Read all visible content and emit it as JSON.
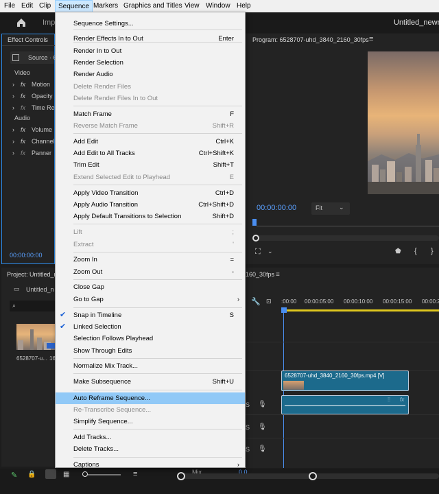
{
  "menubar": [
    "File",
    "Edit",
    "Clip",
    "Sequence",
    "Markers",
    "Graphics and Titles",
    "View",
    "Window",
    "Help"
  ],
  "header": {
    "import_label": "Imp",
    "project_title": "Untitled_newn"
  },
  "effect_controls": {
    "title": "Effect Controls",
    "source_label": "Source · 6",
    "video_label": "Video",
    "audio_label": "Audio",
    "video_effects": [
      "Motion",
      "Opacity",
      "Time Re"
    ],
    "audio_effects": [
      "Volume",
      "Channel",
      "Panner"
    ],
    "timecode": "00:00:00:00"
  },
  "program": {
    "title": "Program: 6528707-uhd_3840_2160_30fps",
    "timecode": "00:00:00:00",
    "fit_label": "Fit"
  },
  "project": {
    "title": "Project: Untitled_n",
    "bin_label": "Untitled_n",
    "clip_name": "6528707-u...",
    "clip_extra": "16"
  },
  "timeline": {
    "seq_tab": "160_30fps",
    "ruler": [
      ":00:00",
      "00:00:05:00",
      "00:00:10:00",
      "00:00:15:00",
      "00:00:2"
    ],
    "video_clip": "6528707-uhd_3840_2160_30fps.mp4 [V]",
    "track_s": "S",
    "mix_label": "Mix",
    "mix_value": "0.0"
  },
  "menu": {
    "items": [
      {
        "label": "Sequence Settings...",
        "shortcut": "",
        "disabled": false,
        "checked": false,
        "submenu": false,
        "highlight": false
      },
      {
        "label": "Render Effects In to Out",
        "shortcut": "Enter",
        "disabled": false,
        "checked": false,
        "submenu": false,
        "highlight": false
      },
      {
        "label": "Render In to Out",
        "shortcut": "",
        "disabled": false,
        "checked": false,
        "submenu": false,
        "highlight": false
      },
      {
        "label": "Render Selection",
        "shortcut": "",
        "disabled": false,
        "checked": false,
        "submenu": false,
        "highlight": false
      },
      {
        "label": "Render Audio",
        "shortcut": "",
        "disabled": false,
        "checked": false,
        "submenu": false,
        "highlight": false
      },
      {
        "label": "Delete Render Files",
        "shortcut": "",
        "disabled": true,
        "checked": false,
        "submenu": false,
        "highlight": false
      },
      {
        "label": "Delete Render Files In to Out",
        "shortcut": "",
        "disabled": true,
        "checked": false,
        "submenu": false,
        "highlight": false
      },
      {
        "label": "Match Frame",
        "shortcut": "F",
        "disabled": false,
        "checked": false,
        "submenu": false,
        "highlight": false
      },
      {
        "label": "Reverse Match Frame",
        "shortcut": "Shift+R",
        "disabled": true,
        "checked": false,
        "submenu": false,
        "highlight": false
      },
      {
        "label": "Add Edit",
        "shortcut": "Ctrl+K",
        "disabled": false,
        "checked": false,
        "submenu": false,
        "highlight": false
      },
      {
        "label": "Add Edit to All Tracks",
        "shortcut": "Ctrl+Shift+K",
        "disabled": false,
        "checked": false,
        "submenu": false,
        "highlight": false
      },
      {
        "label": "Trim Edit",
        "shortcut": "Shift+T",
        "disabled": false,
        "checked": false,
        "submenu": false,
        "highlight": false
      },
      {
        "label": "Extend Selected Edit to Playhead",
        "shortcut": "E",
        "disabled": true,
        "checked": false,
        "submenu": false,
        "highlight": false
      },
      {
        "label": "Apply Video Transition",
        "shortcut": "Ctrl+D",
        "disabled": false,
        "checked": false,
        "submenu": false,
        "highlight": false
      },
      {
        "label": "Apply Audio Transition",
        "shortcut": "Ctrl+Shift+D",
        "disabled": false,
        "checked": false,
        "submenu": false,
        "highlight": false
      },
      {
        "label": "Apply Default Transitions to Selection",
        "shortcut": "Shift+D",
        "disabled": false,
        "checked": false,
        "submenu": false,
        "highlight": false
      },
      {
        "label": "Lift",
        "shortcut": ";",
        "disabled": true,
        "checked": false,
        "submenu": false,
        "highlight": false
      },
      {
        "label": "Extract",
        "shortcut": "'",
        "disabled": true,
        "checked": false,
        "submenu": false,
        "highlight": false
      },
      {
        "label": "Zoom In",
        "shortcut": "=",
        "disabled": false,
        "checked": false,
        "submenu": false,
        "highlight": false
      },
      {
        "label": "Zoom Out",
        "shortcut": "-",
        "disabled": false,
        "checked": false,
        "submenu": false,
        "highlight": false
      },
      {
        "label": "Close Gap",
        "shortcut": "",
        "disabled": false,
        "checked": false,
        "submenu": false,
        "highlight": false
      },
      {
        "label": "Go to Gap",
        "shortcut": "",
        "disabled": false,
        "checked": false,
        "submenu": true,
        "highlight": false
      },
      {
        "label": "Snap in Timeline",
        "shortcut": "S",
        "disabled": false,
        "checked": true,
        "submenu": false,
        "highlight": false
      },
      {
        "label": "Linked Selection",
        "shortcut": "",
        "disabled": false,
        "checked": true,
        "submenu": false,
        "highlight": false
      },
      {
        "label": "Selection Follows Playhead",
        "shortcut": "",
        "disabled": false,
        "checked": false,
        "submenu": false,
        "highlight": false
      },
      {
        "label": "Show Through Edits",
        "shortcut": "",
        "disabled": false,
        "checked": false,
        "submenu": false,
        "highlight": false
      },
      {
        "label": "Normalize Mix Track...",
        "shortcut": "",
        "disabled": false,
        "checked": false,
        "submenu": false,
        "highlight": false
      },
      {
        "label": "Make Subsequence",
        "shortcut": "Shift+U",
        "disabled": false,
        "checked": false,
        "submenu": false,
        "highlight": false
      },
      {
        "label": "Auto Reframe Sequence...",
        "shortcut": "",
        "disabled": false,
        "checked": false,
        "submenu": false,
        "highlight": true
      },
      {
        "label": "Re-Transcribe Sequence...",
        "shortcut": "",
        "disabled": true,
        "checked": false,
        "submenu": false,
        "highlight": false
      },
      {
        "label": "Simplify Sequence...",
        "shortcut": "",
        "disabled": false,
        "checked": false,
        "submenu": false,
        "highlight": false
      },
      {
        "label": "Add Tracks...",
        "shortcut": "",
        "disabled": false,
        "checked": false,
        "submenu": false,
        "highlight": false
      },
      {
        "label": "Delete Tracks...",
        "shortcut": "",
        "disabled": false,
        "checked": false,
        "submenu": false,
        "highlight": false
      },
      {
        "label": "Captions",
        "shortcut": "",
        "disabled": false,
        "checked": false,
        "submenu": true,
        "highlight": false
      }
    ]
  }
}
